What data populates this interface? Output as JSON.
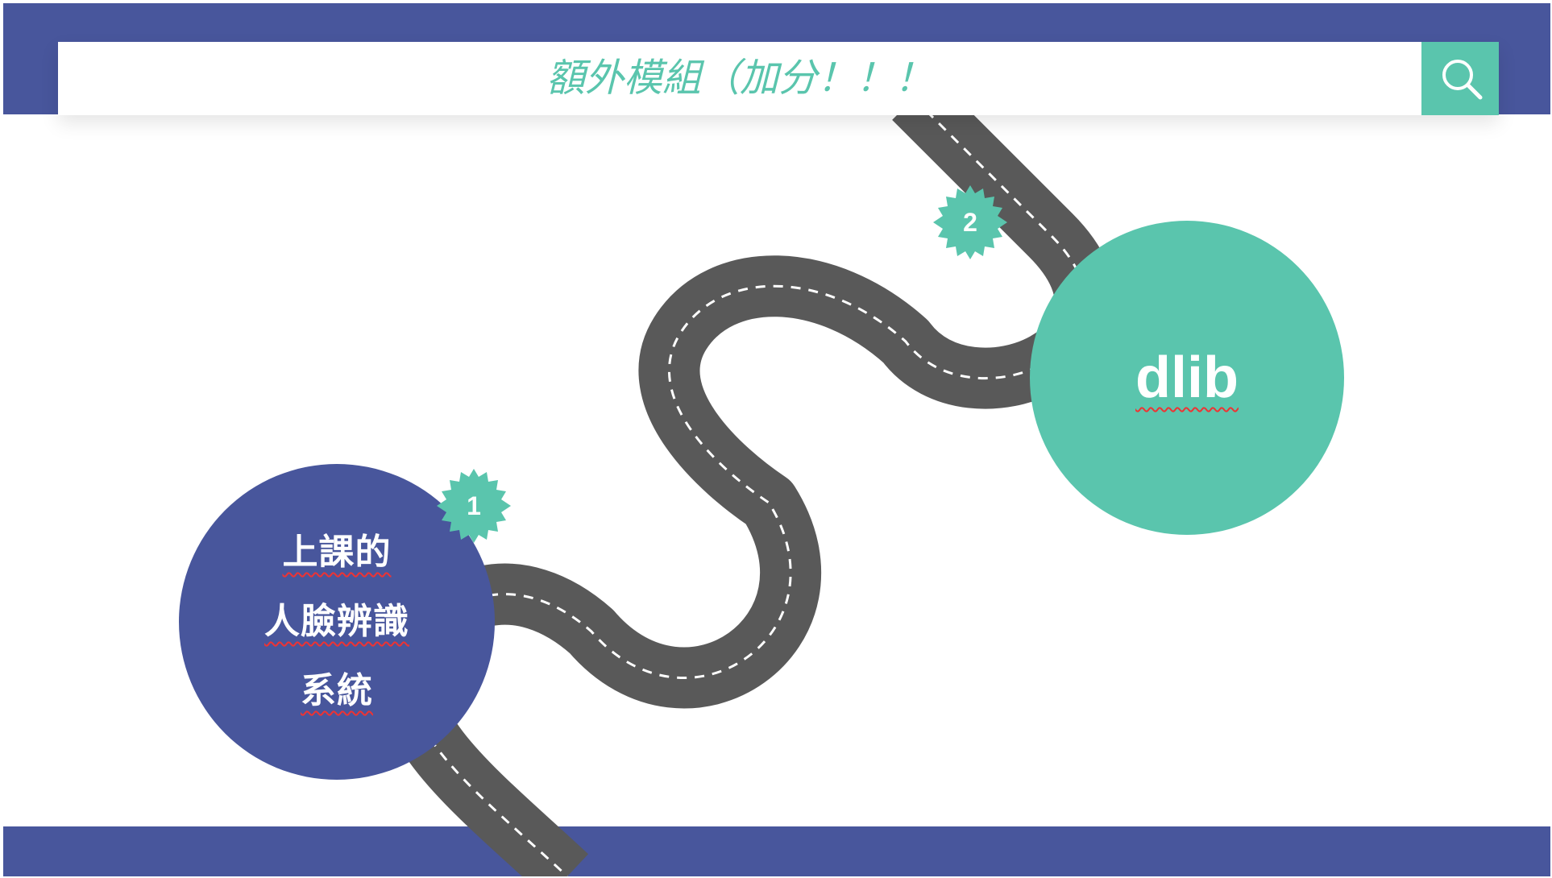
{
  "search": {
    "title": "額外模組（加分！！！"
  },
  "steps": [
    {
      "number": "1",
      "lines": [
        "上課的",
        "人臉辨識",
        "系統"
      ]
    },
    {
      "number": "2",
      "label": "dlib"
    }
  ],
  "icons": {
    "search_button": "search-icon",
    "road": "winding-road",
    "badge": "burst-badge"
  },
  "colors": {
    "navy": "#48569c",
    "teal": "#5ac5ad",
    "road": "#595959",
    "white": "#ffffff"
  }
}
